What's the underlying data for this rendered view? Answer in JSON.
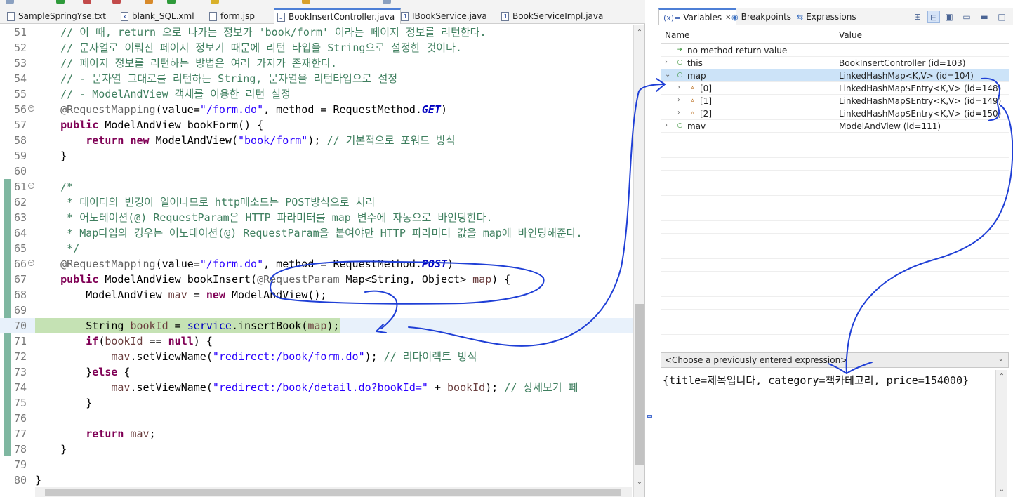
{
  "editor": {
    "tabs": [
      {
        "label": "SampleSpringYse.txt",
        "icon": "text-file-icon"
      },
      {
        "label": "blank_SQL.xml",
        "icon": "xml-file-icon"
      },
      {
        "label": "form.jsp",
        "icon": "jsp-file-icon"
      },
      {
        "label": "BookInsertController.java",
        "icon": "java-file-icon",
        "active": true
      },
      {
        "label": "IBookService.java",
        "icon": "java-file-icon"
      },
      {
        "label": "BookServiceImpl.java",
        "icon": "java-file-icon"
      }
    ],
    "current_line": 70,
    "lines": [
      {
        "n": "51",
        "tokens": [
          [
            "cm",
            "    // 이 때, return 으로 나가는 정보가 'book/form' 이라는 페이지 정보를 리턴한다."
          ]
        ]
      },
      {
        "n": "52",
        "tokens": [
          [
            "cm",
            "    // 문자열로 이뤄진 페이지 정보기 때문에 리턴 타입을 String으로 설정한 것이다."
          ]
        ]
      },
      {
        "n": "53",
        "tokens": [
          [
            "cm",
            "    // 페이지 정보를 리턴하는 방법은 여러 가지가 존재한다."
          ]
        ]
      },
      {
        "n": "54",
        "tokens": [
          [
            "cm",
            "    // - 문자열 그대로를 리턴하는 String, 문자열을 리턴타입으로 설정"
          ]
        ]
      },
      {
        "n": "55",
        "tokens": [
          [
            "cm",
            "    // - ModelAndView 객체를 이용한 리턴 설정"
          ]
        ]
      },
      {
        "n": "56",
        "fold": true,
        "tokens": [
          [
            "an",
            "    @RequestMapping"
          ],
          [
            "",
            "(value="
          ],
          [
            "st",
            "\"/form.do\""
          ],
          [
            "",
            ", method = RequestMethod."
          ],
          [
            "ital",
            "GET"
          ],
          [
            "",
            ")"
          ]
        ]
      },
      {
        "n": "57",
        "tokens": [
          [
            "kw",
            "    public"
          ],
          [
            "",
            " ModelAndView bookForm() {"
          ]
        ]
      },
      {
        "n": "58",
        "tokens": [
          [
            "kw",
            "        return new"
          ],
          [
            "",
            " ModelAndView("
          ],
          [
            "st",
            "\"book/form\""
          ],
          [
            "",
            "); "
          ],
          [
            "cm",
            "// 기본적으로 포워드 방식"
          ]
        ]
      },
      {
        "n": "59",
        "tokens": [
          [
            "",
            "    }"
          ]
        ]
      },
      {
        "n": "60",
        "tokens": [
          [
            "",
            ""
          ]
        ]
      },
      {
        "n": "61",
        "fold": true,
        "tokens": [
          [
            "cm",
            "    /*"
          ]
        ]
      },
      {
        "n": "62",
        "tokens": [
          [
            "cm",
            "     * 데이터의 변경이 일어나므로 http메소드는 POST방식으로 처리"
          ]
        ]
      },
      {
        "n": "63",
        "tokens": [
          [
            "cm",
            "     * 어노테이션(@) RequestParam은 HTTP 파라미터를 map 변수에 자동으로 바인딩한다."
          ]
        ]
      },
      {
        "n": "64",
        "tokens": [
          [
            "cm",
            "     * Map타입의 경우는 어노테이션(@) RequestParam을 붙여야만 HTTP 파라미터 값을 map에 바인딩해준다."
          ]
        ]
      },
      {
        "n": "65",
        "tokens": [
          [
            "cm",
            "     */"
          ]
        ]
      },
      {
        "n": "66",
        "fold": true,
        "tokens": [
          [
            "an",
            "    @RequestMapping"
          ],
          [
            "",
            "(value="
          ],
          [
            "st",
            "\"/form.do\""
          ],
          [
            "",
            ", method = RequestMethod."
          ],
          [
            "ital",
            "POST"
          ],
          [
            "",
            ")"
          ]
        ]
      },
      {
        "n": "67",
        "tokens": [
          [
            "kw",
            "    public"
          ],
          [
            "",
            " ModelAndView bookInsert("
          ],
          [
            "an",
            "@RequestParam"
          ],
          [
            "",
            " Map<String, Object> "
          ],
          [
            "var",
            "map"
          ],
          [
            "",
            ") {"
          ]
        ]
      },
      {
        "n": "68",
        "tokens": [
          [
            "",
            "        ModelAndView "
          ],
          [
            "var",
            "mav"
          ],
          [
            "",
            " = "
          ],
          [
            "kw",
            "new"
          ],
          [
            "",
            " ModelAndView();"
          ]
        ]
      },
      {
        "n": "69",
        "tokens": [
          [
            "",
            ""
          ]
        ]
      },
      {
        "n": "70",
        "tokens": [
          [
            "",
            "        String "
          ],
          [
            "var",
            "bookId"
          ],
          [
            "",
            " = "
          ],
          [
            "fld",
            "service"
          ],
          [
            "",
            ".insertBook("
          ],
          [
            "var",
            "map"
          ],
          [
            "",
            ");"
          ]
        ]
      },
      {
        "n": "71",
        "tokens": [
          [
            "kw",
            "        if"
          ],
          [
            "",
            "("
          ],
          [
            "var",
            "bookId"
          ],
          [
            "",
            " == "
          ],
          [
            "kw",
            "null"
          ],
          [
            "",
            ") {"
          ]
        ]
      },
      {
        "n": "72",
        "tokens": [
          [
            "var",
            "            mav"
          ],
          [
            "",
            ".setViewName("
          ],
          [
            "st",
            "\"redirect:/book/form.do\""
          ],
          [
            "",
            "); "
          ],
          [
            "cm",
            "// 리다이렉트 방식"
          ]
        ]
      },
      {
        "n": "73",
        "tokens": [
          [
            "",
            "        }"
          ],
          [
            "kw",
            "else"
          ],
          [
            "",
            " {"
          ]
        ]
      },
      {
        "n": "74",
        "tokens": [
          [
            "var",
            "            mav"
          ],
          [
            "",
            ".setViewName("
          ],
          [
            "st",
            "\"redirect:/book/detail.do?bookId=\""
          ],
          [
            "",
            " + "
          ],
          [
            "var",
            "bookId"
          ],
          [
            "",
            "); "
          ],
          [
            "cm",
            "// 상세보기 페"
          ]
        ]
      },
      {
        "n": "75",
        "tokens": [
          [
            "",
            "        }"
          ]
        ]
      },
      {
        "n": "76",
        "tokens": [
          [
            "",
            ""
          ]
        ]
      },
      {
        "n": "77",
        "tokens": [
          [
            "kw",
            "        return"
          ],
          [
            "",
            " "
          ],
          [
            "var",
            "mav"
          ],
          [
            "",
            ";"
          ]
        ]
      },
      {
        "n": "78",
        "tokens": [
          [
            "",
            "    }"
          ]
        ]
      },
      {
        "n": "79",
        "tokens": [
          [
            "",
            ""
          ]
        ]
      },
      {
        "n": "80",
        "tokens": [
          [
            "",
            "}"
          ]
        ]
      }
    ]
  },
  "panel": {
    "tabs": {
      "variables": "Variables",
      "breakpoints": "Breakpoints",
      "expressions": "Expressions"
    },
    "columns": {
      "name": "Name",
      "value": "Value"
    },
    "rows": [
      {
        "name": "no method return value",
        "value": "",
        "depth": 0,
        "expander": "",
        "icon": "return-icon"
      },
      {
        "name": "this",
        "value": "BookInsertController  (id=103)",
        "depth": 0,
        "expander": "›",
        "icon": "local-var-icon"
      },
      {
        "name": "map",
        "value": "LinkedHashMap<K,V>  (id=104)",
        "depth": 0,
        "expander": "⌄",
        "icon": "local-var-icon",
        "selected": true
      },
      {
        "name": "[0]",
        "value": "LinkedHashMap$Entry<K,V>  (id=148)",
        "depth": 1,
        "expander": "›",
        "icon": "field-icon"
      },
      {
        "name": "[1]",
        "value": "LinkedHashMap$Entry<K,V>  (id=149)",
        "depth": 1,
        "expander": "›",
        "icon": "field-icon"
      },
      {
        "name": "[2]",
        "value": "LinkedHashMap$Entry<K,V>  (id=150)",
        "depth": 1,
        "expander": "›",
        "icon": "field-icon"
      },
      {
        "name": "mav",
        "value": "ModelAndView  (id=111)",
        "depth": 0,
        "expander": "›",
        "icon": "local-var-icon"
      }
    ],
    "expression_placeholder": "<Choose a previously entered expression>",
    "detail_text": "{title=제목입니다, category=책카테고리, price=154000}"
  }
}
